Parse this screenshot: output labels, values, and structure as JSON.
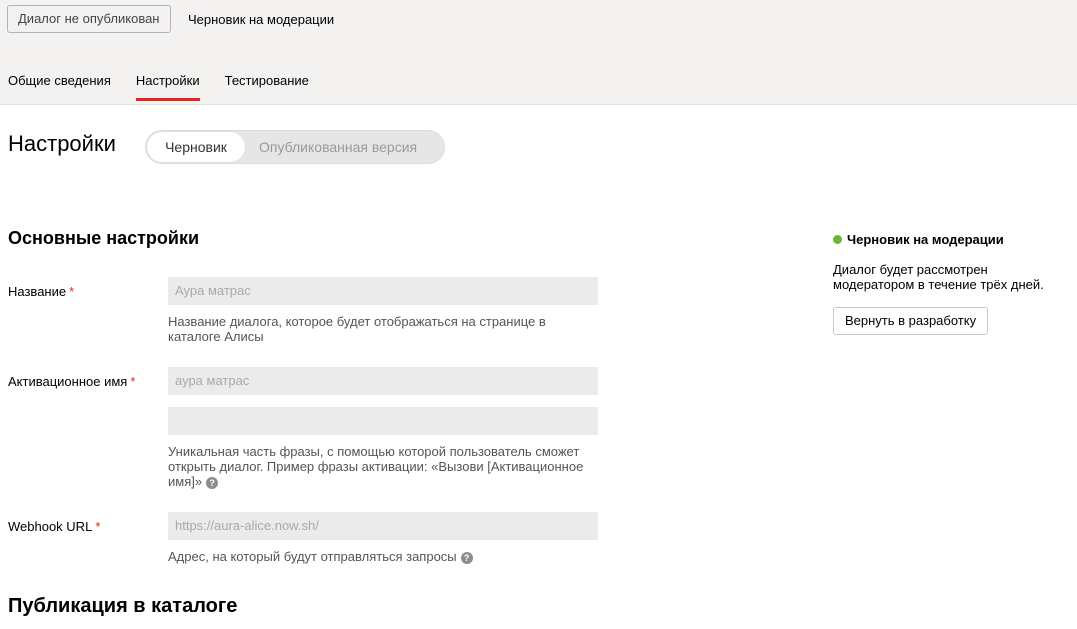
{
  "header": {
    "status_button": "Диалог не опубликован",
    "status_text": "Черновик на модерации",
    "tabs": [
      {
        "label": "Общие сведения"
      },
      {
        "label": "Настройки"
      },
      {
        "label": "Тестирование"
      }
    ],
    "active_tab": "Настройки"
  },
  "page": {
    "title": "Настройки",
    "version_switch": {
      "active": "Черновик",
      "inactive": "Опубликованная версия"
    }
  },
  "main_settings": {
    "title": "Основные настройки",
    "required_mark": "*",
    "name": {
      "label": "Название",
      "value": "Аура матрас",
      "hint": "Название диалога, которое будет отображаться на странице в каталоге Алисы"
    },
    "activation": {
      "label": "Активационное имя",
      "value": "аура матрас",
      "value2": "",
      "hint": "Уникальная часть фразы, с помощью которой пользователь сможет открыть диалог. Пример фразы активации: «Вызови [Активационное имя]»"
    },
    "webhook": {
      "label": "Webhook URL",
      "value": "https://aura-alice.now.sh/",
      "hint": "Адрес, на который будут отправляться запросы"
    }
  },
  "catalog_section": {
    "title": "Публикация в каталоге"
  },
  "sidebar": {
    "status": "Черновик на модерации",
    "status_color": "#6cb52e",
    "description": "Диалог будет рассмотрен модератором в течение трёх дней.",
    "return_button": "Вернуть в разработку"
  },
  "colors": {
    "accent": "#e52620",
    "topbar_bg": "#f3f2f0",
    "input_bg": "#ebebeb"
  }
}
